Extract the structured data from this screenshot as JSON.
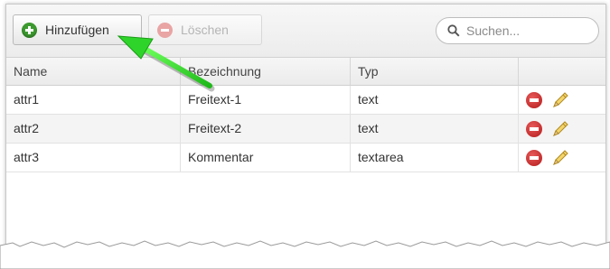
{
  "toolbar": {
    "add_label": "Hinzufügen",
    "delete_label": "Löschen",
    "search_placeholder": "Suchen..."
  },
  "table": {
    "columns": [
      "Name",
      "Bezeichnung",
      "Typ",
      ""
    ],
    "rows": [
      {
        "name": "attr1",
        "bezeichnung": "Freitext-1",
        "typ": "text"
      },
      {
        "name": "attr2",
        "bezeichnung": "Freitext-2",
        "typ": "text"
      },
      {
        "name": "attr3",
        "bezeichnung": "Kommentar",
        "typ": "textarea"
      }
    ]
  },
  "icons": {
    "add": "plus-circle-icon",
    "delete": "minus-circle-icon",
    "search": "search-icon",
    "row_delete": "remove-circle-icon",
    "row_edit": "pencil-icon"
  },
  "colors": {
    "add_icon": "#3c9a2e",
    "delete_icon": "#c62828",
    "annotation_arrow": "#33dd33"
  }
}
